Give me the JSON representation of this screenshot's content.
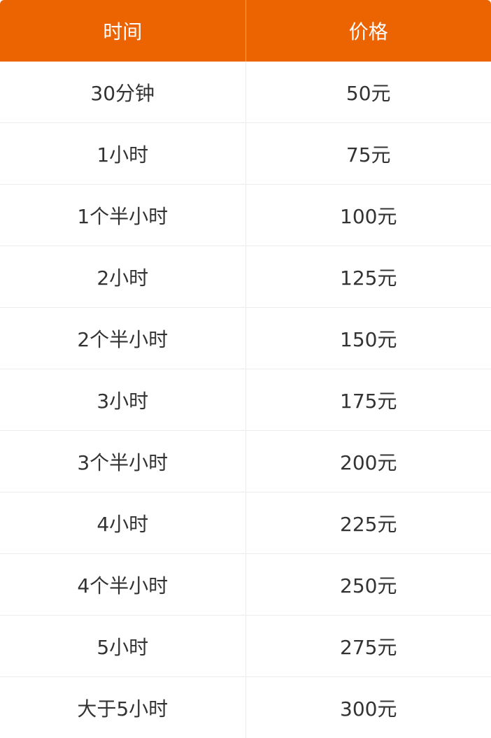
{
  "table": {
    "headers": {
      "time": "时间",
      "price": "价格"
    },
    "rows": [
      {
        "time": "30分钟",
        "price": "50元"
      },
      {
        "time": "1小时",
        "price": "75元"
      },
      {
        "time": "1个半小时",
        "price": "100元"
      },
      {
        "time": "2小时",
        "price": "125元"
      },
      {
        "time": "2个半小时",
        "price": "150元"
      },
      {
        "time": "3小时",
        "price": "175元"
      },
      {
        "time": "3个半小时",
        "price": "200元"
      },
      {
        "time": "4小时",
        "price": "225元"
      },
      {
        "time": "4个半小时",
        "price": "250元"
      },
      {
        "time": "5小时",
        "price": "275元"
      },
      {
        "time": "大于5小时",
        "price": "300元"
      }
    ]
  },
  "colors": {
    "header_bg": "#ec6302",
    "header_text": "#ffffff",
    "body_text": "#333333",
    "divider": "#ececec"
  }
}
